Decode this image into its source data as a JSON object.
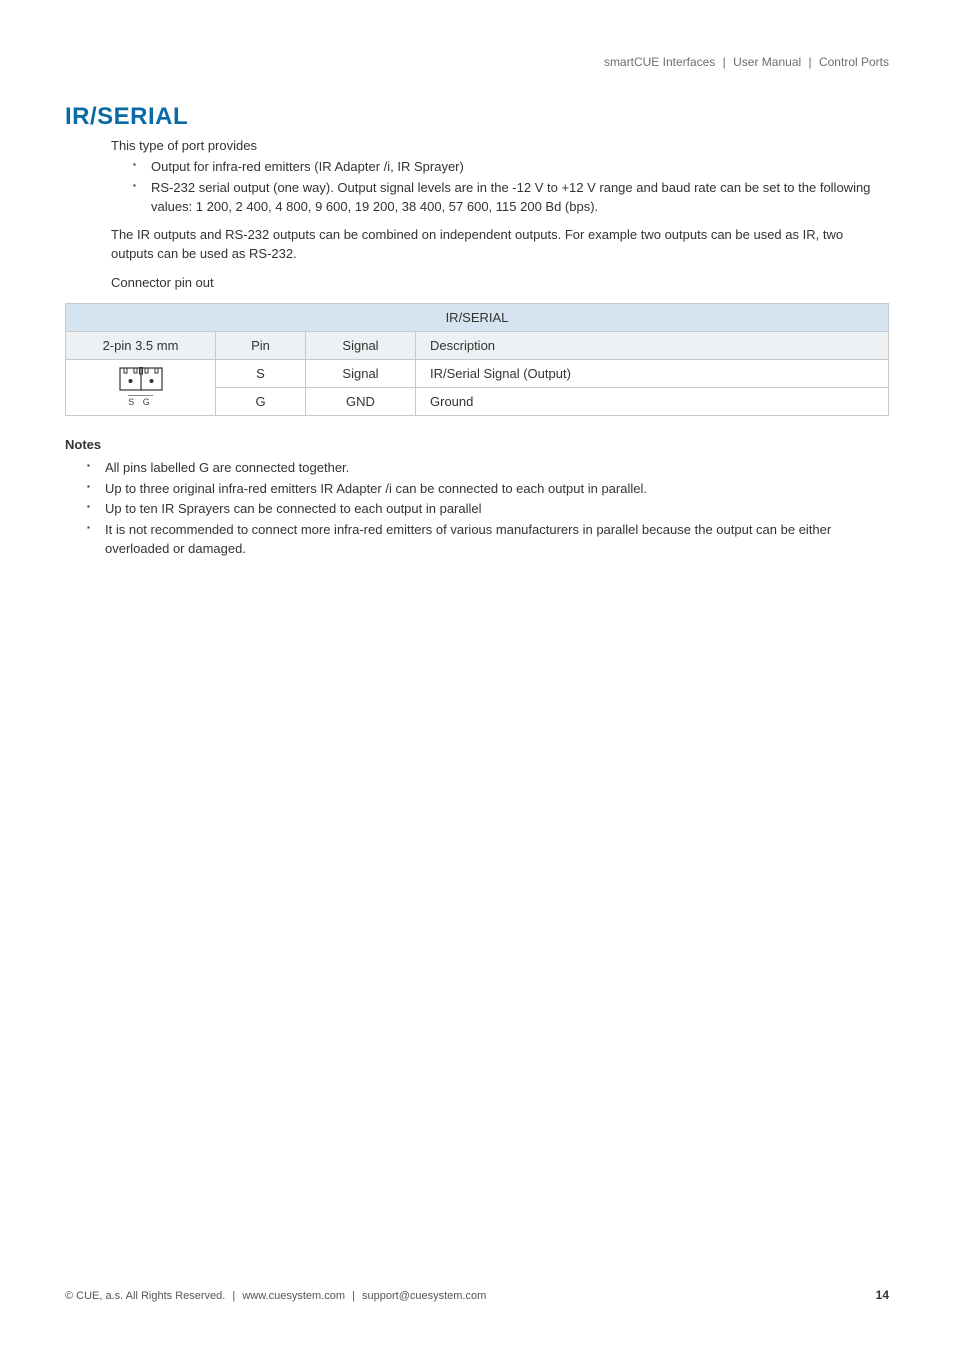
{
  "breadcrumb": {
    "product": "smartCUE Interfaces",
    "doc": "User Manual",
    "section": "Control Ports"
  },
  "heading": "IR/SERIAL",
  "intro": "This type of port provides",
  "features": [
    "Output for infra-red emitters (IR Adapter /i, IR Sprayer)",
    "RS-232 serial output (one way). Output signal levels are in the -12 V to +12 V range and baud rate can be set to the following values: 1 200, 2 400, 4 800, 9 600, 19 200, 38 400, 57 600, 115 200 Bd (bps)."
  ],
  "combine_note": "The IR outputs and RS-232 outputs can be combined on independent outputs. For example two outputs can be used as IR, two outputs can be used as RS-232.",
  "pinout_label": "Connector pin out",
  "table": {
    "title": "IR/SERIAL",
    "headers": {
      "conn": "2-pin 3.5 mm",
      "pin": "Pin",
      "signal": "Signal",
      "desc": "Description"
    },
    "connector_labels": "S G",
    "rows": [
      {
        "pin": "S",
        "signal": "Signal",
        "desc": "IR/Serial Signal (Output)"
      },
      {
        "pin": "G",
        "signal": "GND",
        "desc": "Ground"
      }
    ]
  },
  "notes_heading": "Notes",
  "notes": [
    "All pins labelled G are connected together.",
    "Up to three original infra-red emitters IR Adapter /i can be connected to each output in parallel.",
    "Up to ten IR Sprayers can be connected to each output in parallel",
    "It is not recommended to connect more infra-red emitters of various manufacturers in parallel because the output can be either overloaded or damaged."
  ],
  "footer": {
    "copyright": "© CUE, a.s. All Rights Reserved.",
    "url": "www.cuesystem.com",
    "email": "support@cuesystem.com",
    "page": "14"
  }
}
